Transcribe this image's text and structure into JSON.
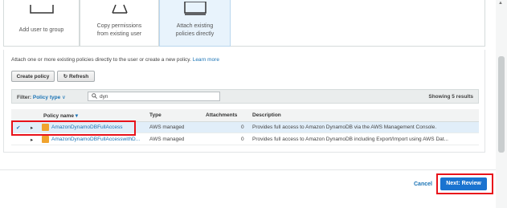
{
  "cards": [
    {
      "label": "Add user to group",
      "icon": "group-icon",
      "selected": false
    },
    {
      "label": "Copy permissions from existing user",
      "icon": "user-icon",
      "selected": false
    },
    {
      "label": "Attach existing policies directly",
      "icon": "document-icon",
      "selected": true
    }
  ],
  "intro": {
    "text": "Attach one or more existing policies directly to the user or create a new policy.",
    "link": "Learn more"
  },
  "toolbar": {
    "create_policy": "Create policy",
    "refresh": "Refresh",
    "refresh_icon": "↻"
  },
  "filter": {
    "label": "Filter:",
    "dropdown": "Policy type",
    "dropdown_caret": "∨",
    "search_icon": "🔍",
    "search_value": "dyn",
    "showing": "Showing 5 results"
  },
  "table": {
    "columns": [
      "Policy name",
      "Type",
      "Attachments",
      "Description"
    ],
    "sort_icon": "▾",
    "rows": [
      {
        "checked": true,
        "expand": "▸",
        "name": "AmazonDynamoDBFullAccess",
        "type": "AWS managed",
        "attachments": "0",
        "description": "Provides full access to Amazon DynamoDB via the AWS Management Console."
      },
      {
        "checked": false,
        "expand": "▸",
        "name": "AmazonDynamoDBFullAccesswithD...",
        "type": "AWS managed",
        "attachments": "0",
        "description": "Provides full access to Amazon DynamoDB including Export/Import using AWS Dat..."
      }
    ],
    "check_mark": "✔"
  },
  "footer": {
    "cancel": "Cancel",
    "next": "Next: Review"
  },
  "colors": {
    "accent": "#1a73b5",
    "primary_button": "#1a73d0",
    "highlight": "#e8121b"
  }
}
